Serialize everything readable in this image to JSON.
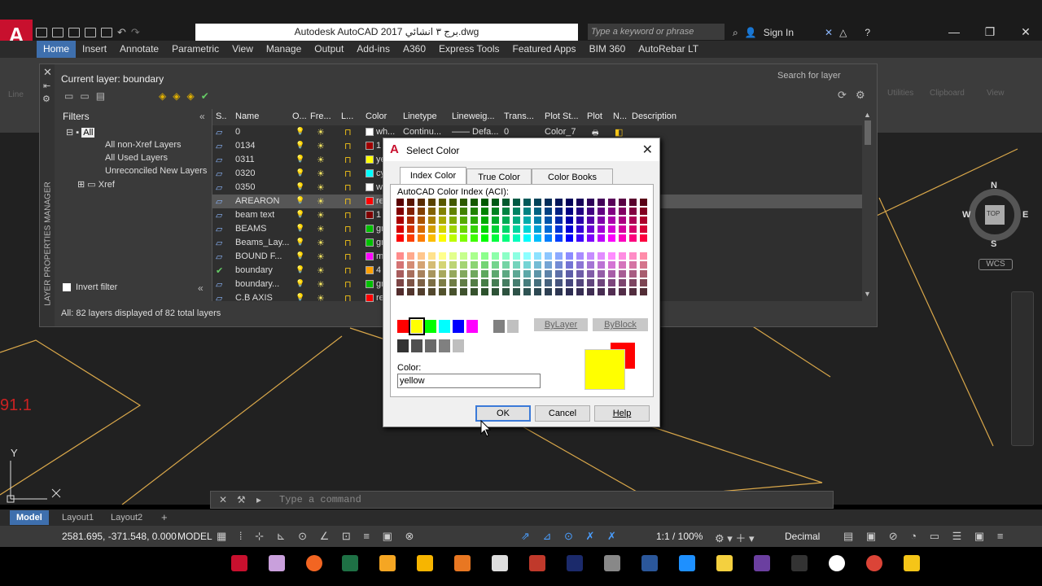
{
  "app": {
    "title": "Autodesk AutoCAD 2017   برج ٣ انشائي.dwg",
    "logo_letter": "A",
    "search_placeholder": "Type a keyword or phrase",
    "sign_in": "Sign In",
    "window_controls": [
      "—",
      "❐",
      "✕"
    ]
  },
  "ribbon": {
    "tabs": [
      "Home",
      "Insert",
      "Annotate",
      "Parametric",
      "View",
      "Manage",
      "Output",
      "Add-ins",
      "A360",
      "Express Tools",
      "Featured Apps",
      "BIM 360",
      "AutoRebar LT"
    ],
    "active_tab": "Home",
    "panel_labels": [
      "Line",
      "Utilities",
      "Clipboard",
      "View"
    ]
  },
  "layer_manager": {
    "side_label": "LAYER PROPERTIES MANAGER",
    "current_layer": "Current layer: boundary",
    "search_placeholder": "Search for layer",
    "filters_title": "Filters",
    "filters": [
      "All",
      "All non-Xref Layers",
      "All Used Layers",
      "Unreconciled New Layers",
      "Xref"
    ],
    "invert_filter": "Invert filter",
    "status": "All: 82 layers displayed of 82 total layers",
    "columns": [
      "S..",
      "Name",
      "O...",
      "Fre...",
      "L...",
      "Color",
      "Linetype",
      "Lineweig...",
      "Trans...",
      "Plot St...",
      "Plot",
      "N...",
      "Description"
    ],
    "rows": [
      {
        "name": "0",
        "color_text": "wh...",
        "swatch": "#ffffff",
        "linetype": "Continu...",
        "lineweight": "—— Defa...",
        "trans": "0",
        "plotstyle": "Color_7"
      },
      {
        "name": "0134",
        "color_text": "1",
        "swatch": "#a00000"
      },
      {
        "name": "0311",
        "color_text": "ye",
        "swatch": "#ffff00"
      },
      {
        "name": "0320",
        "color_text": "cy",
        "swatch": "#00ffff"
      },
      {
        "name": "0350",
        "color_text": "w",
        "swatch": "#ffffff"
      },
      {
        "name": "AREARON",
        "color_text": "re",
        "swatch": "#ff0000"
      },
      {
        "name": "beam text",
        "color_text": "1",
        "swatch": "#800000"
      },
      {
        "name": "BEAMS",
        "color_text": "gr",
        "swatch": "#00c000"
      },
      {
        "name": "Beams_Lay...",
        "color_text": "gr",
        "swatch": "#00c000"
      },
      {
        "name": "BOUND F...",
        "color_text": "m",
        "swatch": "#ff00ff"
      },
      {
        "name": "boundary",
        "color_text": "4",
        "swatch": "#ffa000"
      },
      {
        "name": "boundary...",
        "color_text": "gr",
        "swatch": "#00c000"
      },
      {
        "name": "C.B AXIS",
        "color_text": "re",
        "swatch": "#ff0000"
      }
    ]
  },
  "dialog": {
    "title": "Select Color",
    "tabs": [
      "Index Color",
      "True Color",
      "Color Books"
    ],
    "aci_label": "AutoCAD Color Index (ACI):",
    "by_layer": "ByLayer",
    "by_block": "ByBlock",
    "color_label": "Color:",
    "color_value": "yellow",
    "ok": "OK",
    "cancel": "Cancel",
    "help": "Help",
    "std_colors": [
      "#ff0000",
      "#ffff00",
      "#00ff00",
      "#00ffff",
      "#0000ff",
      "#ff00ff",
      "#ffffff"
    ],
    "gray_colors": [
      "#808080",
      "#c0c0c0"
    ],
    "gray_row": [
      "#333333",
      "#505050",
      "#696969",
      "#808080",
      "#bebebe",
      "#ffffff"
    ],
    "preview_new": "#ffff00",
    "preview_old": "#ff0000"
  },
  "viewcube": {
    "n": "N",
    "s": "S",
    "e": "E",
    "w": "W",
    "top": "TOP",
    "wcs": "WCS"
  },
  "drawing": {
    "dim_text": "91.1",
    "y_axis": "Y"
  },
  "command": {
    "placeholder": "Type a command"
  },
  "layouts": {
    "tabs": [
      "Model",
      "Layout1",
      "Layout2"
    ],
    "plus": "+"
  },
  "statusbar": {
    "coords": "2581.695, -371.548, 0.000",
    "model": "MODEL",
    "scale": "1:1 / 100%",
    "units": "Decimal"
  }
}
